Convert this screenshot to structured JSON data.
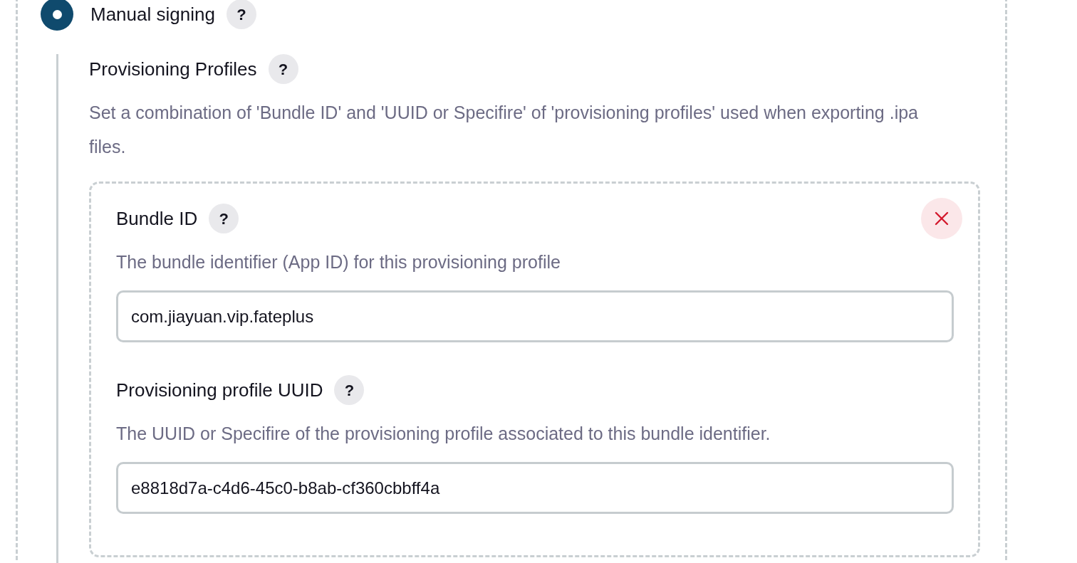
{
  "option": {
    "label": "Manual signing",
    "help": "?",
    "selected": true
  },
  "section": {
    "title": "Provisioning Profiles",
    "help": "?",
    "description": "Set a combination of 'Bundle ID' and 'UUID or Specifire' of 'provisioning profiles' used when exporting .ipa files."
  },
  "profiles": [
    {
      "fields": [
        {
          "label": "Bundle ID",
          "help": "?",
          "description": "The bundle identifier (App ID) for this provisioning profile",
          "value": "com.jiayuan.vip.fateplus"
        },
        {
          "label": "Provisioning profile UUID",
          "help": "?",
          "description": "The UUID or Specifire of the provisioning profile associated to this bundle identifier.",
          "value": "e8818d7a-c4d6-45c0-b8ab-cf360cbbff4a"
        }
      ]
    }
  ]
}
